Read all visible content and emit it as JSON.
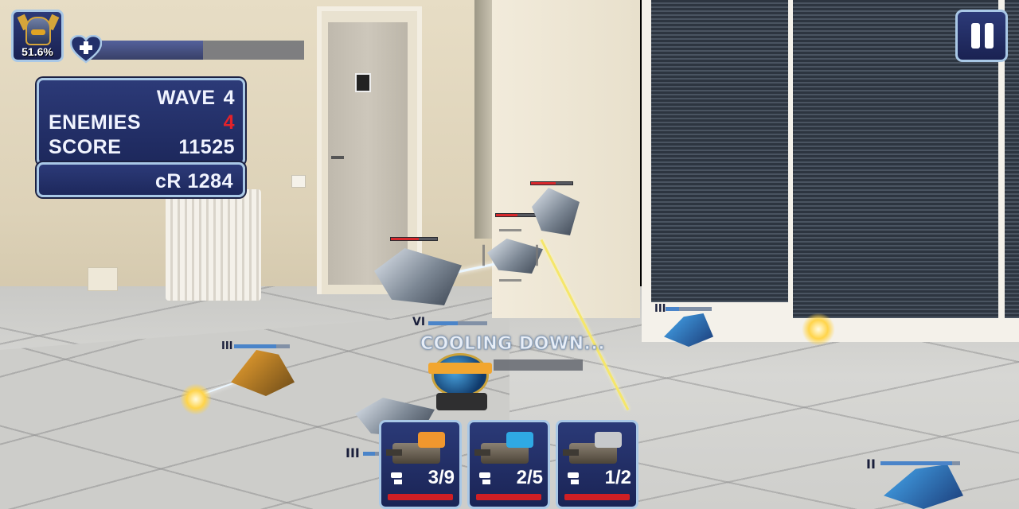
{
  "player": {
    "avatar_percent": "51.6%",
    "health_fraction": 0.53
  },
  "stats": {
    "wave_label": "WAVE",
    "wave_value": "4",
    "enemies_label": "ENEMIES",
    "enemies_value": "4",
    "score_label": "SCORE",
    "score_value": "11525",
    "credits_text": "cR 1284"
  },
  "status": {
    "cooling_text": "COOLING DOWN..."
  },
  "player_unit": {
    "level": "VI",
    "level_fraction": 0.5
  },
  "towers": [
    {
      "level": "III",
      "level_fraction": 0.75
    },
    {
      "level": "III",
      "level_fraction": 0.3
    },
    {
      "level": "III",
      "level_fraction": 0.7
    },
    {
      "level": "II",
      "level_fraction": 0.9
    }
  ],
  "cards": [
    {
      "count": "3/9",
      "accent": "#f0972e",
      "icon": "turret-icon"
    },
    {
      "count": "2/5",
      "accent": "#2fa9e4",
      "icon": "turret-icon"
    },
    {
      "count": "1/2",
      "accent": "#c7c9cc",
      "icon": "turret-icon"
    }
  ],
  "enemies": [
    {
      "health_fraction": 0.6
    },
    {
      "health_fraction": 0.5
    },
    {
      "health_fraction": 0.6
    },
    {
      "health_fraction": 0.4
    }
  ],
  "colors": {
    "hud_fill": "#1d285c",
    "hud_border": "#a9c8e6",
    "danger": "#e3222a"
  }
}
